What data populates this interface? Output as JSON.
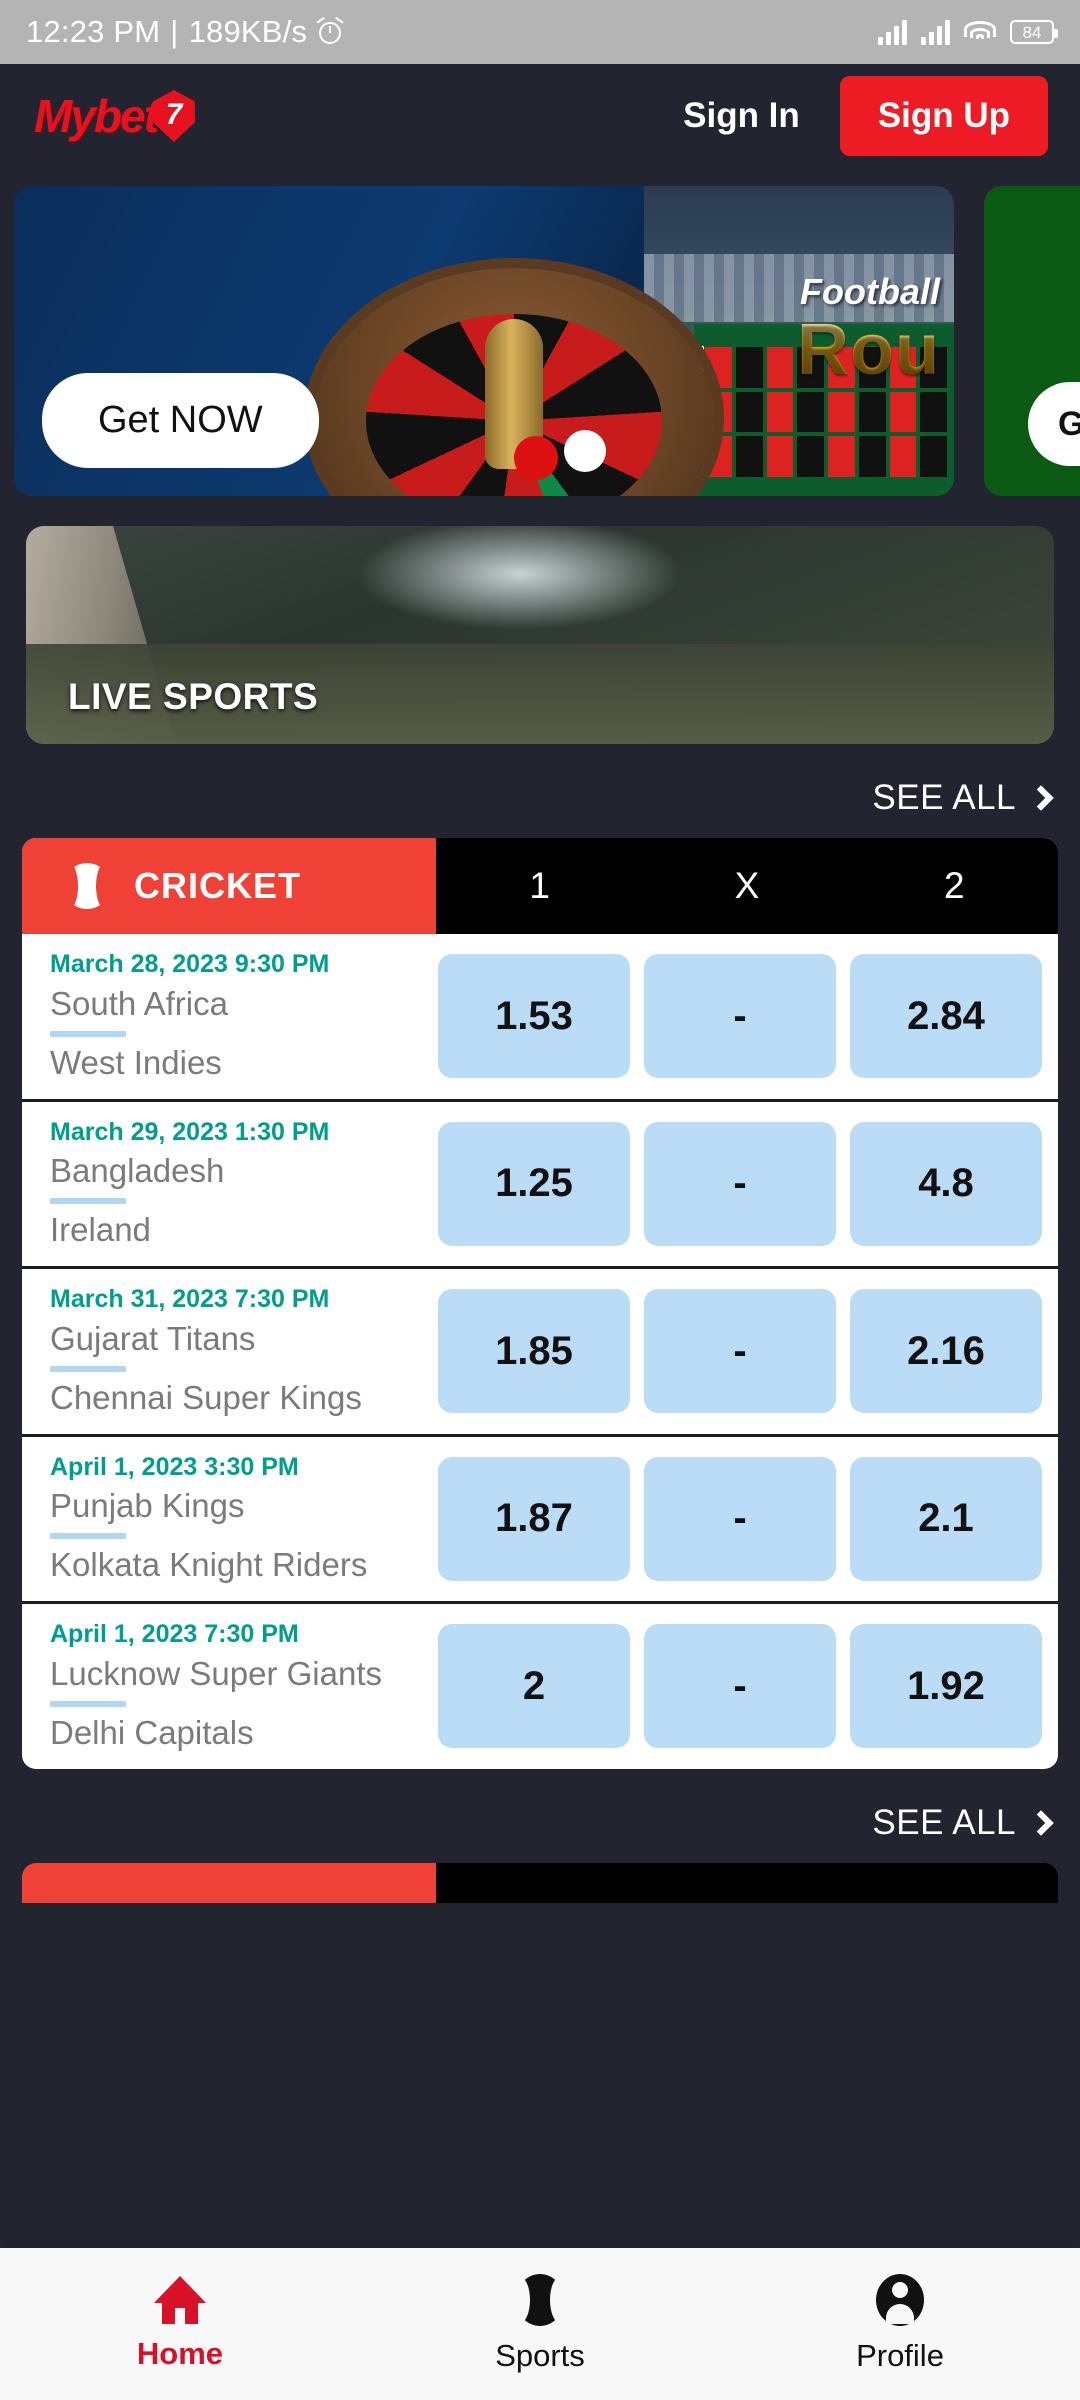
{
  "status_bar": {
    "time": "12:23 PM",
    "separator": "|",
    "network_speed": "189KB/s",
    "battery_level": "84",
    "icons": [
      "alarm-icon",
      "signal-icon",
      "signal-icon",
      "wifi-icon",
      "battery-icon"
    ]
  },
  "header": {
    "logo_text": "Mybet",
    "logo_badge": "7",
    "sign_in_label": "Sign In",
    "sign_up_label": "Sign Up",
    "accent_red": "#ED1C24",
    "background": "#22252F"
  },
  "banners": [
    {
      "id": "roulette-banner",
      "title_small": "Football",
      "title_big": "Rou",
      "cta_label": "Get NOW"
    },
    {
      "id": "green-banner",
      "cta_label": "G"
    }
  ],
  "live_sports": {
    "label": "LIVE SPORTS"
  },
  "see_all_top": {
    "label": "SEE ALL",
    "icon": "chevron-right-icon"
  },
  "see_all_bottom": {
    "label": "SEE ALL",
    "icon": "chevron-right-icon"
  },
  "match_table": {
    "sport_label": "CRICKET",
    "sport_icon": "cricket-ball-icon",
    "odds_headers": [
      "1",
      "X",
      "2"
    ],
    "header_bg": "#EF4136",
    "odds_header_bg": "#000000",
    "date_color": "#009E8E",
    "odds_cell_bg": "#BBDCF7",
    "rows": [
      {
        "date": "March 28, 2023 9:30 PM",
        "team_home": "South Africa",
        "team_away": "West Indies",
        "odds": [
          "1.53",
          "-",
          "2.84"
        ]
      },
      {
        "date": "March 29, 2023 1:30 PM",
        "team_home": "Bangladesh",
        "team_away": "Ireland",
        "odds": [
          "1.25",
          "-",
          "4.8"
        ]
      },
      {
        "date": "March 31, 2023 7:30 PM",
        "team_home": "Gujarat Titans",
        "team_away": "Chennai Super Kings",
        "odds": [
          "1.85",
          "-",
          "2.16"
        ]
      },
      {
        "date": "April 1, 2023 3:30 PM",
        "team_home": "Punjab Kings",
        "team_away": "Kolkata Knight Riders",
        "odds": [
          "1.87",
          "-",
          "2.1"
        ]
      },
      {
        "date": "April 1, 2023 7:30 PM",
        "team_home": "Lucknow Super Giants",
        "team_away": "Delhi Capitals",
        "odds": [
          "2",
          "-",
          "1.92"
        ]
      }
    ]
  },
  "bottom_nav": {
    "active": "Home",
    "active_color": "#D81128",
    "items": [
      {
        "label": "Home",
        "icon": "home-icon"
      },
      {
        "label": "Sports",
        "icon": "cricket-ball-icon"
      },
      {
        "label": "Profile",
        "icon": "person-icon"
      }
    ]
  }
}
